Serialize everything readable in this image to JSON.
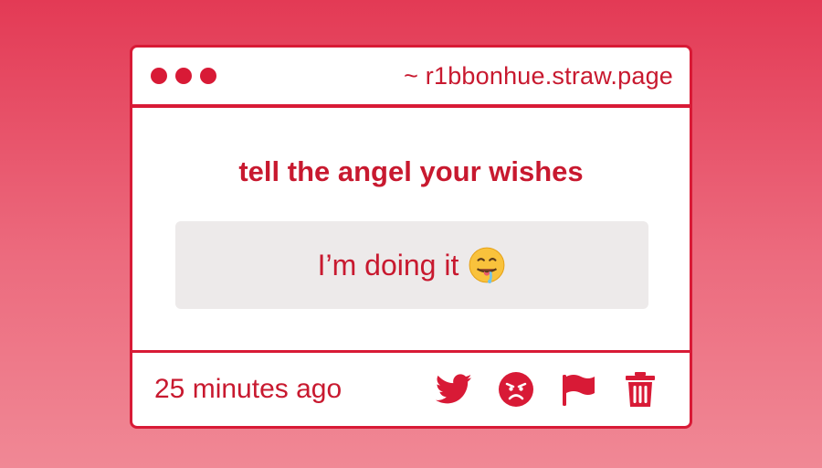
{
  "window": {
    "url": "~ r1bbonhue.straw.page"
  },
  "card": {
    "prompt": "tell the angel your wishes",
    "answer": "I’m doing it",
    "answer_emoji": "drooling-face-emoji"
  },
  "footer": {
    "timestamp": "25 minutes ago",
    "icons": [
      "twitter-icon",
      "angry-face-icon",
      "flag-icon",
      "trash-icon"
    ]
  },
  "colors": {
    "accent": "#d81a36",
    "text": "#c8192f",
    "answer_bg": "#edeaea",
    "bg_top": "#e33a55",
    "bg_bottom": "#f08895"
  }
}
